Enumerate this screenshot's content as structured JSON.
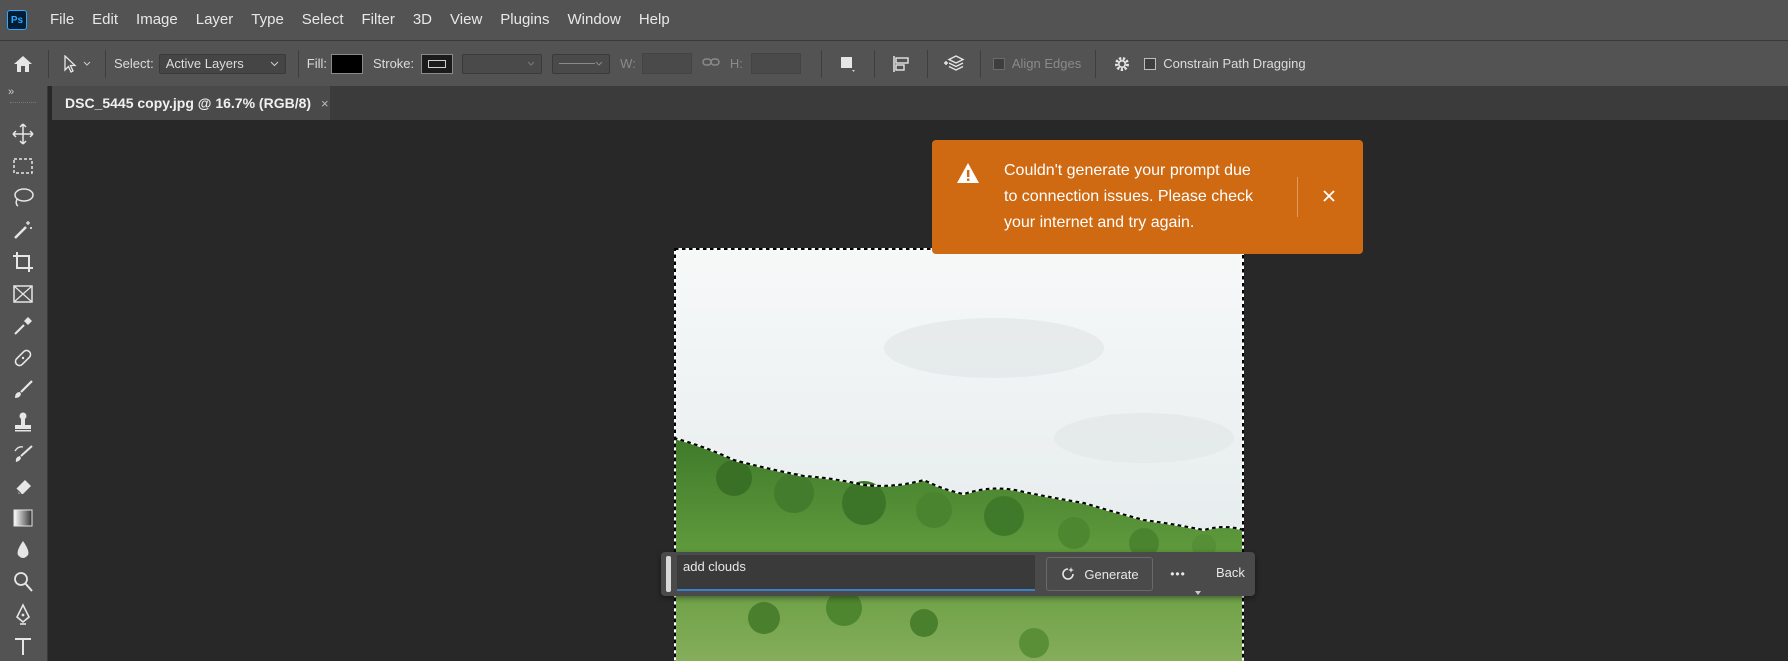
{
  "app": {
    "logo": "Ps"
  },
  "menu": [
    "File",
    "Edit",
    "Image",
    "Layer",
    "Type",
    "Select",
    "Filter",
    "3D",
    "View",
    "Plugins",
    "Window",
    "Help"
  ],
  "options": {
    "select_label": "Select:",
    "select_value": "Active Layers",
    "fill_label": "Fill:",
    "fill_color": "#000000",
    "stroke_label": "Stroke:",
    "w_label": "W:",
    "h_label": "H:",
    "align_edges_label": "Align Edges",
    "constrain_label": "Constrain Path Dragging"
  },
  "document_tab": {
    "title": "DSC_5445 copy.jpg @ 16.7% (RGB/8)",
    "close": "×"
  },
  "tools": [
    "move-icon",
    "rect-marquee-icon",
    "lasso-icon",
    "magic-wand-icon",
    "crop-icon",
    "frame-icon",
    "eyedropper-icon",
    "healing-icon",
    "brush-icon",
    "stamp-icon",
    "history-brush-icon",
    "eraser-icon",
    "gradient-icon",
    "blur-icon",
    "dodge-icon",
    "pen-icon",
    "type-icon"
  ],
  "toast": {
    "message": "Couldn't generate your prompt due to connection issues. Please check your internet and try again.",
    "color": "#cf6a13"
  },
  "generative_bar": {
    "prompt_value": "add clouds",
    "generate_label": "Generate",
    "more_label": "•••",
    "back_label": "Back"
  }
}
